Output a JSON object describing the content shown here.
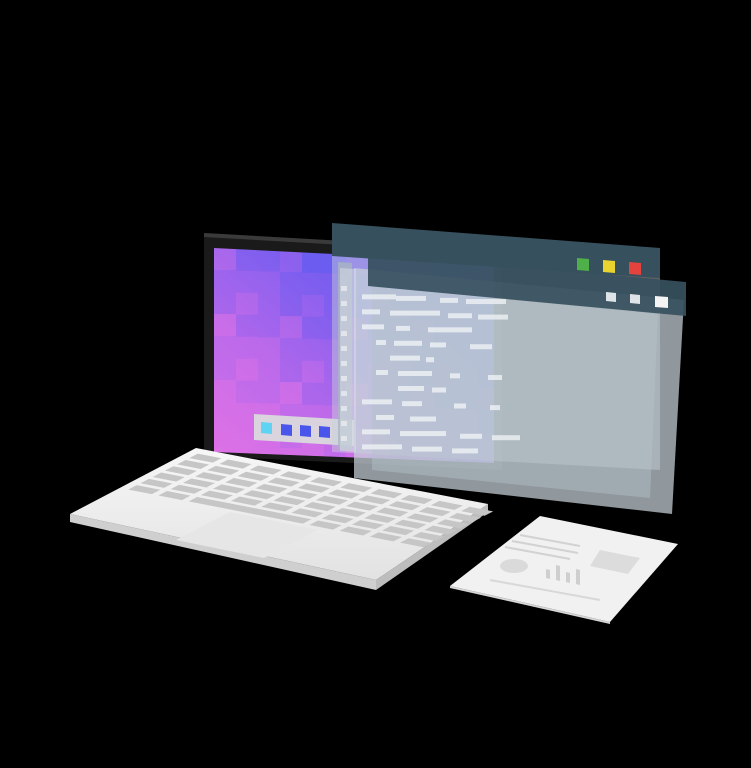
{
  "scene": {
    "background": "#000000",
    "laptop": {
      "body_color": "#f2f2f2",
      "key_color": "#c6c6c6",
      "bezel_color": "#1a1a1a",
      "wallpaper_colors": [
        "#4b57f2",
        "#5a5cf0",
        "#6e5ef0",
        "#8a61ee",
        "#a666ec",
        "#c46de9",
        "#dc72e6"
      ]
    },
    "dock": {
      "icons": [
        "terminal-icon",
        "app-icon",
        "app-icon",
        "app-icon"
      ],
      "colors": [
        "#5fd3f3",
        "#4a55ec",
        "#4a55ec",
        "#4a55ec"
      ]
    },
    "windows": {
      "titlebar_color": "#37505e",
      "glass_color": "#c8d3da",
      "controls": [
        {
          "name": "minimize-icon",
          "color": "#4fb04a"
        },
        {
          "name": "maximize-icon",
          "color": "#e8d32f"
        },
        {
          "name": "close-icon",
          "color": "#e2433c"
        }
      ]
    },
    "document": {
      "paper_color": "#f1f1f1",
      "ink_color": "#cfcfcf"
    }
  }
}
